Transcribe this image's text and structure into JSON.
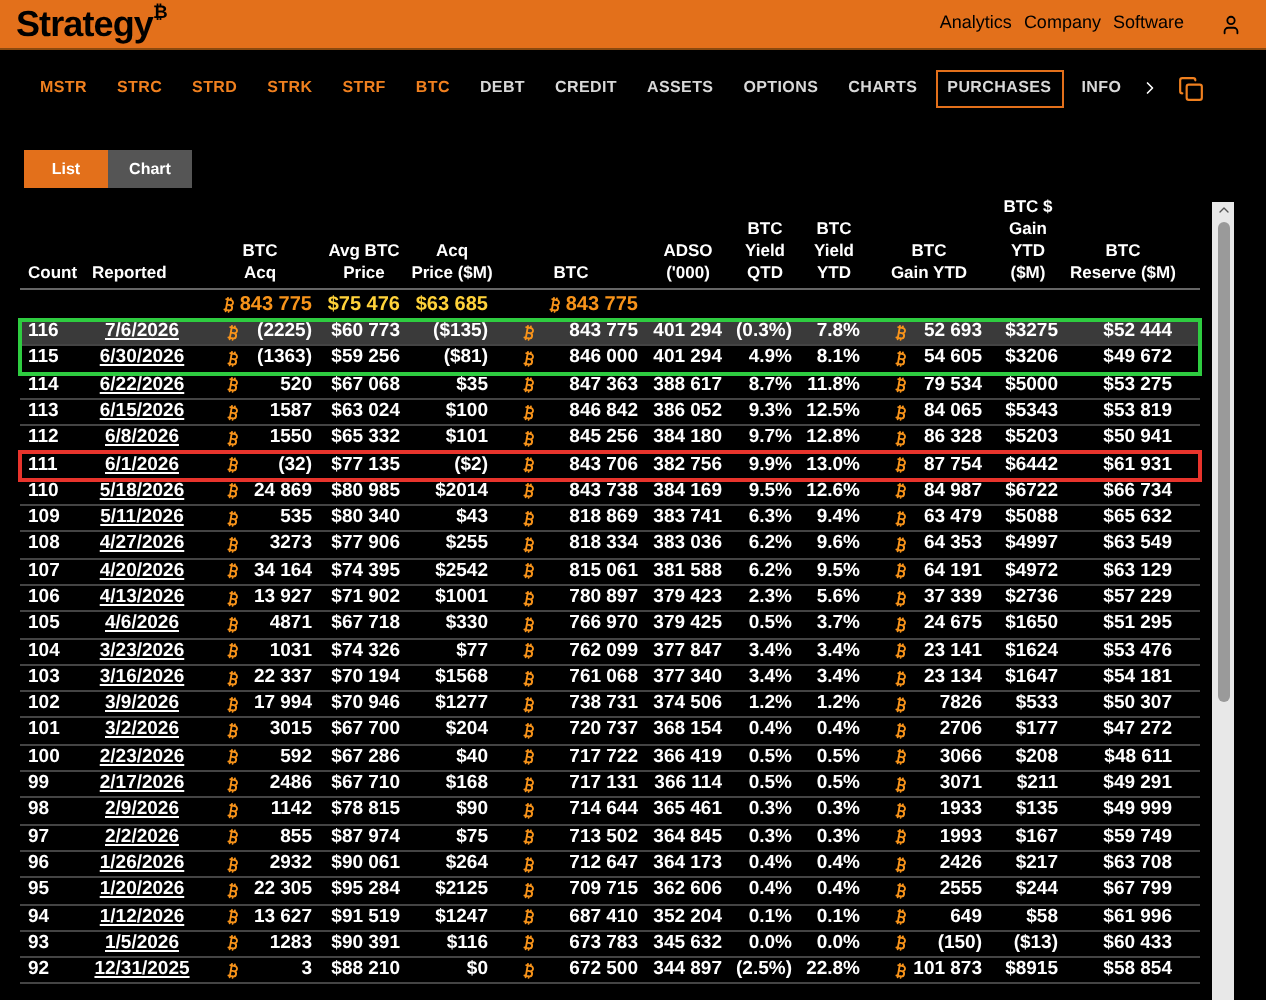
{
  "header": {
    "logo": "Strategy",
    "logo_mark": "₿",
    "links": [
      "Analytics",
      "Company",
      "Software"
    ]
  },
  "tabs": [
    {
      "label": "MSTR",
      "kind": "ticker",
      "selected": false
    },
    {
      "label": "STRC",
      "kind": "ticker",
      "selected": false
    },
    {
      "label": "STRD",
      "kind": "ticker",
      "selected": false
    },
    {
      "label": "STRK",
      "kind": "ticker",
      "selected": false
    },
    {
      "label": "STRF",
      "kind": "ticker",
      "selected": false
    },
    {
      "label": "BTC",
      "kind": "ticker",
      "selected": false
    },
    {
      "label": "DEBT",
      "kind": "page",
      "selected": false
    },
    {
      "label": "CREDIT",
      "kind": "page",
      "selected": false
    },
    {
      "label": "ASSETS",
      "kind": "page",
      "selected": false
    },
    {
      "label": "OPTIONS",
      "kind": "page",
      "selected": false
    },
    {
      "label": "CHARTS",
      "kind": "page",
      "selected": false
    },
    {
      "label": "PURCHASES",
      "kind": "page",
      "selected": true
    },
    {
      "label": "INFO",
      "kind": "page",
      "selected": false
    }
  ],
  "view_toggle": [
    {
      "label": "List",
      "selected": true
    },
    {
      "label": "Chart",
      "selected": false
    }
  ],
  "table": {
    "columns": [
      {
        "label": "Count",
        "kind": "count"
      },
      {
        "label": "Reported",
        "kind": "link"
      },
      {
        "label": "BTC\nAcq",
        "kind": "btc",
        "total": "843 775"
      },
      {
        "label": "Avg BTC\nPrice",
        "kind": "num",
        "total": "$75 476"
      },
      {
        "label": "Acq\nPrice ($M)",
        "kind": "num",
        "total": "$63 685"
      },
      {
        "label": "BTC",
        "kind": "btc",
        "total": "843 775"
      },
      {
        "label": "ADSO\n('000)",
        "kind": "num"
      },
      {
        "label": "BTC\nYield\nQTD",
        "kind": "num"
      },
      {
        "label": "BTC\nYield\nYTD",
        "kind": "num"
      },
      {
        "label": "BTC\nGain YTD",
        "kind": "btc"
      },
      {
        "label": "BTC $\nGain\nYTD\n($M)",
        "kind": "num"
      },
      {
        "label": "BTC\nReserve ($M)",
        "kind": "num"
      }
    ],
    "rows": [
      {
        "selected": true,
        "color": "#2ecc40",
        "cells": [
          "116",
          "7/6/2026",
          "(2225)",
          "$60 773",
          "($135)",
          "843 775",
          "401 294",
          "(0.3%)",
          "7.8%",
          "52 693",
          "$3275",
          "$52 444"
        ]
      },
      {
        "selected": false,
        "color": "#2ecc40",
        "cells": [
          "115",
          "6/30/2026",
          "(1363)",
          "$59 256",
          "($81)",
          "846 000",
          "401 294",
          "4.9%",
          "8.1%",
          "54 605",
          "$3206",
          "$49 672"
        ]
      },
      {
        "selected": false,
        "cells": [
          "114",
          "6/22/2026",
          "520",
          "$67 068",
          "$35",
          "847 363",
          "388 617",
          "8.7%",
          "11.8%",
          "79 534",
          "$5000",
          "$53 275"
        ]
      },
      {
        "selected": false,
        "cells": [
          "113",
          "6/15/2026",
          "1587",
          "$63 024",
          "$100",
          "846 842",
          "386 052",
          "9.3%",
          "12.5%",
          "84 065",
          "$5343",
          "$53 819"
        ]
      },
      {
        "selected": false,
        "cells": [
          "112",
          "6/8/2026",
          "1550",
          "$65 332",
          "$101",
          "845 256",
          "384 180",
          "9.7%",
          "12.8%",
          "86 328",
          "$5203",
          "$50 941"
        ]
      },
      {
        "selected": false,
        "color": "#e8342c",
        "cells": [
          "111",
          "6/1/2026",
          "(32)",
          "$77 135",
          "($2)",
          "843 706",
          "382 756",
          "9.9%",
          "13.0%",
          "87 754",
          "$6442",
          "$61 931"
        ]
      },
      {
        "selected": false,
        "cells": [
          "110",
          "5/18/2026",
          "24 869",
          "$80 985",
          "$2014",
          "843 738",
          "384 169",
          "9.5%",
          "12.6%",
          "84 987",
          "$6722",
          "$66 734"
        ]
      },
      {
        "selected": false,
        "cells": [
          "109",
          "5/11/2026",
          "535",
          "$80 340",
          "$43",
          "818 869",
          "383 741",
          "6.3%",
          "9.4%",
          "63 479",
          "$5088",
          "$65 632"
        ]
      },
      {
        "selected": false,
        "cells": [
          "108",
          "4/27/2026",
          "3273",
          "$77 906",
          "$255",
          "818 334",
          "383 036",
          "6.2%",
          "9.6%",
          "64 353",
          "$4997",
          "$63 549"
        ]
      },
      {
        "selected": false,
        "cells": [
          "107",
          "4/20/2026",
          "34 164",
          "$74 395",
          "$2542",
          "815 061",
          "381 588",
          "6.2%",
          "9.5%",
          "64 191",
          "$4972",
          "$63 129"
        ]
      },
      {
        "selected": false,
        "cells": [
          "106",
          "4/13/2026",
          "13 927",
          "$71 902",
          "$1001",
          "780 897",
          "379 423",
          "2.3%",
          "5.6%",
          "37 339",
          "$2736",
          "$57 229"
        ]
      },
      {
        "selected": false,
        "cells": [
          "105",
          "4/6/2026",
          "4871",
          "$67 718",
          "$330",
          "766 970",
          "379 425",
          "0.5%",
          "3.7%",
          "24 675",
          "$1650",
          "$51 295"
        ]
      },
      {
        "selected": false,
        "cells": [
          "104",
          "3/23/2026",
          "1031",
          "$74 326",
          "$77",
          "762 099",
          "377 847",
          "3.4%",
          "3.4%",
          "23 141",
          "$1624",
          "$53 476"
        ]
      },
      {
        "selected": false,
        "cells": [
          "103",
          "3/16/2026",
          "22 337",
          "$70 194",
          "$1568",
          "761 068",
          "377 340",
          "3.4%",
          "3.4%",
          "23 134",
          "$1647",
          "$54 181"
        ]
      },
      {
        "selected": false,
        "cells": [
          "102",
          "3/9/2026",
          "17 994",
          "$70 946",
          "$1277",
          "738 731",
          "374 506",
          "1.2%",
          "1.2%",
          "7826",
          "$533",
          "$50 307"
        ]
      },
      {
        "selected": false,
        "cells": [
          "101",
          "3/2/2026",
          "3015",
          "$67 700",
          "$204",
          "720 737",
          "368 154",
          "0.4%",
          "0.4%",
          "2706",
          "$177",
          "$47 272"
        ]
      },
      {
        "selected": false,
        "cells": [
          "100",
          "2/23/2026",
          "592",
          "$67 286",
          "$40",
          "717 722",
          "366 419",
          "0.5%",
          "0.5%",
          "3066",
          "$208",
          "$48 611"
        ]
      },
      {
        "selected": false,
        "cells": [
          "99",
          "2/17/2026",
          "2486",
          "$67 710",
          "$168",
          "717 131",
          "366 114",
          "0.5%",
          "0.5%",
          "3071",
          "$211",
          "$49 291"
        ]
      },
      {
        "selected": false,
        "cells": [
          "98",
          "2/9/2026",
          "1142",
          "$78 815",
          "$90",
          "714 644",
          "365 461",
          "0.3%",
          "0.3%",
          "1933",
          "$135",
          "$49 999"
        ]
      },
      {
        "selected": false,
        "cells": [
          "97",
          "2/2/2026",
          "855",
          "$87 974",
          "$75",
          "713 502",
          "364 845",
          "0.3%",
          "0.3%",
          "1993",
          "$167",
          "$59 749"
        ]
      },
      {
        "selected": false,
        "cells": [
          "96",
          "1/26/2026",
          "2932",
          "$90 061",
          "$264",
          "712 647",
          "364 173",
          "0.4%",
          "0.4%",
          "2426",
          "$217",
          "$63 708"
        ]
      },
      {
        "selected": false,
        "cells": [
          "95",
          "1/20/2026",
          "22 305",
          "$95 284",
          "$2125",
          "709 715",
          "362 606",
          "0.4%",
          "0.4%",
          "2555",
          "$244",
          "$67 799"
        ]
      },
      {
        "selected": false,
        "cells": [
          "94",
          "1/12/2026",
          "13 627",
          "$91 519",
          "$1247",
          "687 410",
          "352 204",
          "0.1%",
          "0.1%",
          "649",
          "$58",
          "$61 996"
        ]
      },
      {
        "selected": false,
        "cells": [
          "93",
          "1/5/2026",
          "1283",
          "$90 391",
          "$116",
          "673 783",
          "345 632",
          "0.0%",
          "0.0%",
          "(150)",
          "($13)",
          "$60 433"
        ]
      },
      {
        "selected": false,
        "cells": [
          "92",
          "12/31/2025",
          "3",
          "$88 210",
          "$0",
          "672 500",
          "344 897",
          "(2.5%)",
          "22.8%",
          "101 873",
          "$8915",
          "$58 854"
        ]
      }
    ]
  }
}
